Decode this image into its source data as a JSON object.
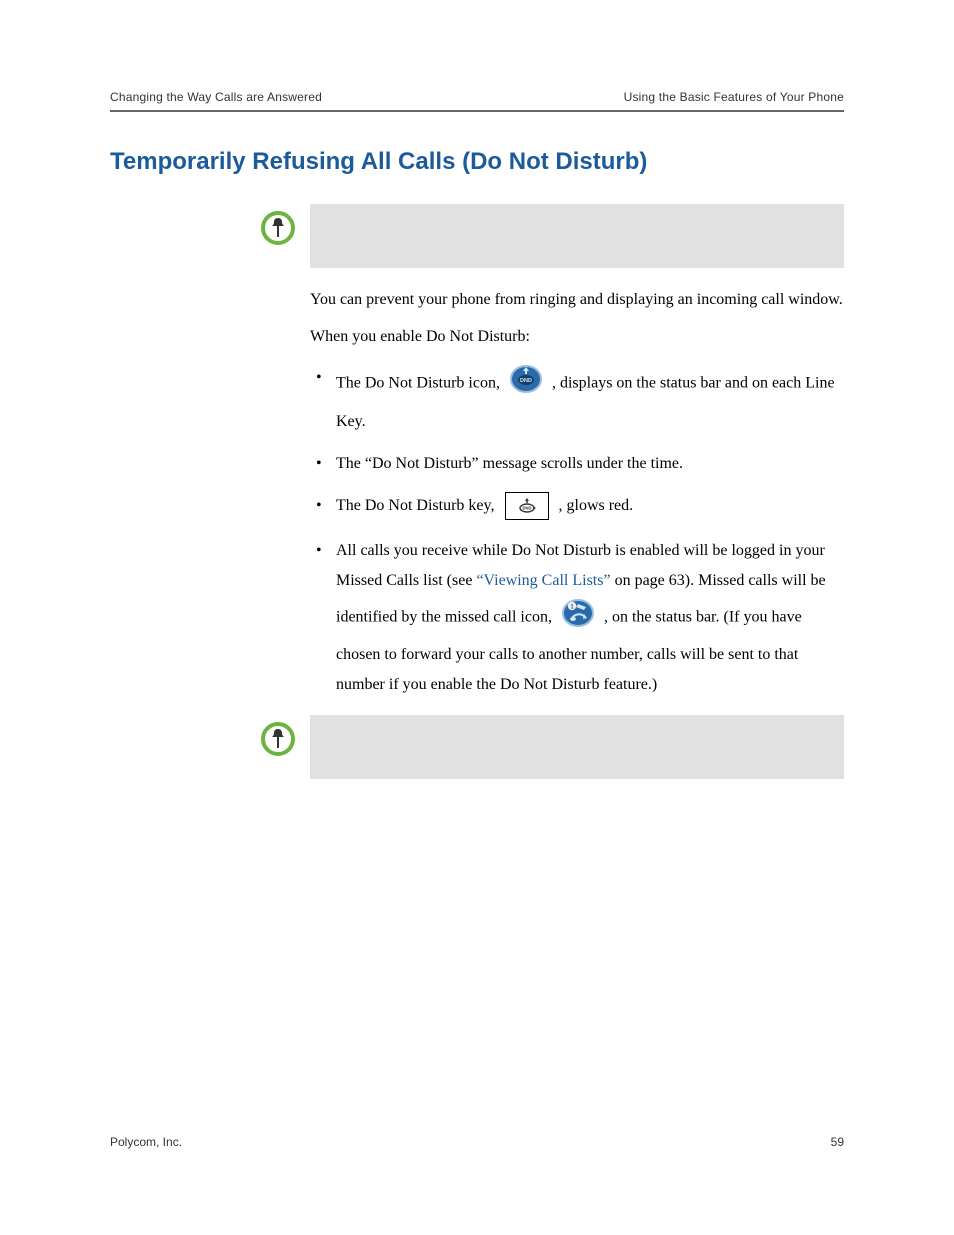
{
  "header": {
    "left": "Changing the Way Calls are Answered",
    "right": "Using the Basic Features of Your Phone"
  },
  "title": "Temporarily Refusing All Calls (Do Not Disturb)",
  "body": {
    "p1": "You can prevent your phone from ringing and displaying an incoming call window.",
    "p2": "When you enable Do Not Disturb:",
    "b1_a": "The Do Not Disturb icon, ",
    "b1_b": " , displays on the status bar and on each Line Key.",
    "b2": "The “Do Not Disturb” message scrolls under the time.",
    "b3_a": "The Do Not Disturb key, ",
    "b3_b": " , glows red.",
    "b4_a": "All calls you receive while Do Not Disturb is enabled will be logged in your Missed Calls list (see ",
    "b4_link": "“Viewing Call Lists”",
    "b4_b": " on page 63). Missed calls will be identified by the missed call icon, ",
    "b4_c": " , on the status bar. (If you have chosen to forward your calls to another number, calls will be sent to that number if you enable the Do Not Disturb feature.)"
  },
  "footer": {
    "left": "Polycom, Inc.",
    "right": "59"
  }
}
